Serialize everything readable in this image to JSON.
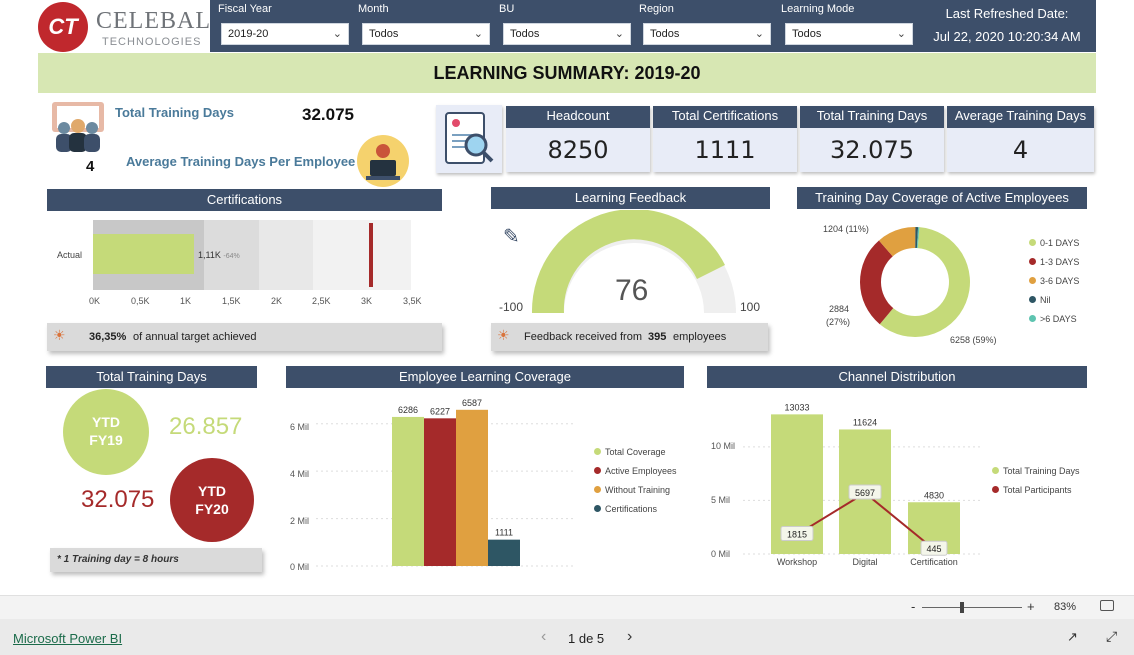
{
  "header": {
    "logo_main": "CELEBAL",
    "logo_sub": "TECHNOLOGIES",
    "logo_badge": "CT",
    "filters": [
      {
        "label": "Fiscal Year",
        "value": "2019-20"
      },
      {
        "label": "Month",
        "value": "Todos"
      },
      {
        "label": "BU",
        "value": "Todos"
      },
      {
        "label": "Region",
        "value": "Todos"
      },
      {
        "label": "Learning Mode",
        "value": "Todos"
      }
    ],
    "refresh_label": "Last Refreshed Date:",
    "refresh_value": "Jul 22, 2020 10:20:34 AM"
  },
  "title": "LEARNING SUMMARY: 2019-20",
  "summary": {
    "total_training_days_label": "Total Training Days",
    "total_training_days_value": "32.075",
    "avg_value": "4",
    "avg_label": "Average Training Days Per Employee"
  },
  "kpis": [
    {
      "title": "Headcount",
      "value": "8250"
    },
    {
      "title": "Total Certifications",
      "value": "1111"
    },
    {
      "title": "Total Training Days",
      "value": "32.075"
    },
    {
      "title": "Average Training Days",
      "value": "4"
    }
  ],
  "certifications": {
    "title": "Certifications",
    "row_label": "Actual",
    "bar_label": "1,11K",
    "bar_pct": "-64%",
    "ticks": [
      "0K",
      "0,5K",
      "1K",
      "1,5K",
      "2K",
      "2,5K",
      "3K",
      "3,5K"
    ],
    "target_pct": "36,35%",
    "target_text": "of annual target achieved",
    "colors": {
      "bar": "#c5da79",
      "target": "#a52a2a"
    }
  },
  "feedback": {
    "title": "Learning Feedback",
    "value": "76",
    "min": "-100",
    "max": "100",
    "note_prefix": "Feedback received from",
    "note_count": "395",
    "note_suffix": "employees"
  },
  "coverage": {
    "title": "Training Day Coverage of Active Employees",
    "label_top": "1204 (11%)",
    "label_left_1": "2884",
    "label_left_2": "(27%)",
    "label_bottom": "6258 (59%)",
    "legend": [
      {
        "name": "0-1 DAYS",
        "color": "#c5da79"
      },
      {
        "name": "1-3 DAYS",
        "color": "#a52a2a"
      },
      {
        "name": "3-6 DAYS",
        "color": "#e0a040"
      },
      {
        "name": "Nil",
        "color": "#2e5664"
      },
      {
        "name": ">6 DAYS",
        "color": "#5ec4b0"
      }
    ]
  },
  "total_training": {
    "title": "Total Training Days",
    "ytd1_line1": "YTD",
    "ytd1_line2": "FY19",
    "ytd1_value": "26.857",
    "ytd2_line1": "YTD",
    "ytd2_line2": "FY20",
    "ytd2_value": "32.075",
    "note": "* 1 Training day = 8 hours"
  },
  "learning_coverage": {
    "title": "Employee Learning Coverage",
    "y_ticks": [
      "6 Mil",
      "4 Mil",
      "2 Mil",
      "0 Mil"
    ],
    "legend": [
      "Total Coverage",
      "Active Employees",
      "Without Training",
      "Certifications"
    ]
  },
  "channel": {
    "title": "Channel Distribution",
    "y_ticks": [
      "10 Mil",
      "5 Mil",
      "0 Mil"
    ],
    "legend": [
      "Total Training Days",
      "Total Participants"
    ]
  },
  "chart_data": [
    {
      "type": "bar",
      "title": "Employee Learning Coverage",
      "series": [
        {
          "name": "Total Coverage",
          "values": [
            6286
          ],
          "color": "#c5da79"
        },
        {
          "name": "Active Employees",
          "values": [
            6227
          ],
          "color": "#a52a2a"
        },
        {
          "name": "Without Training",
          "values": [
            6587
          ],
          "color": "#e0a040"
        },
        {
          "name": "Certifications",
          "values": [
            1111
          ],
          "color": "#2e5664"
        }
      ],
      "ylim": [
        0,
        7000
      ]
    },
    {
      "type": "bar",
      "title": "Channel Distribution",
      "categories": [
        "Workshop",
        "Digital",
        "Certification"
      ],
      "series": [
        {
          "name": "Total Training Days",
          "values": [
            13033,
            11624,
            4830
          ],
          "color": "#c5da79"
        },
        {
          "name": "Total Participants",
          "values": [
            1815,
            5697,
            445
          ],
          "color": "#a52a2a"
        }
      ],
      "ylim": [
        0,
        14000
      ]
    },
    {
      "type": "pie",
      "title": "Training Day Coverage of Active Employees",
      "categories": [
        "0-1 DAYS",
        "1-3 DAYS",
        "3-6 DAYS",
        "Nil",
        ">6 DAYS"
      ],
      "values": [
        6258,
        2884,
        1204,
        80,
        40
      ]
    }
  ],
  "footer": {
    "zoom": "83%",
    "zoom_fraction": 0.4,
    "brand": "Microsoft Power BI",
    "page": "1 de 5"
  }
}
